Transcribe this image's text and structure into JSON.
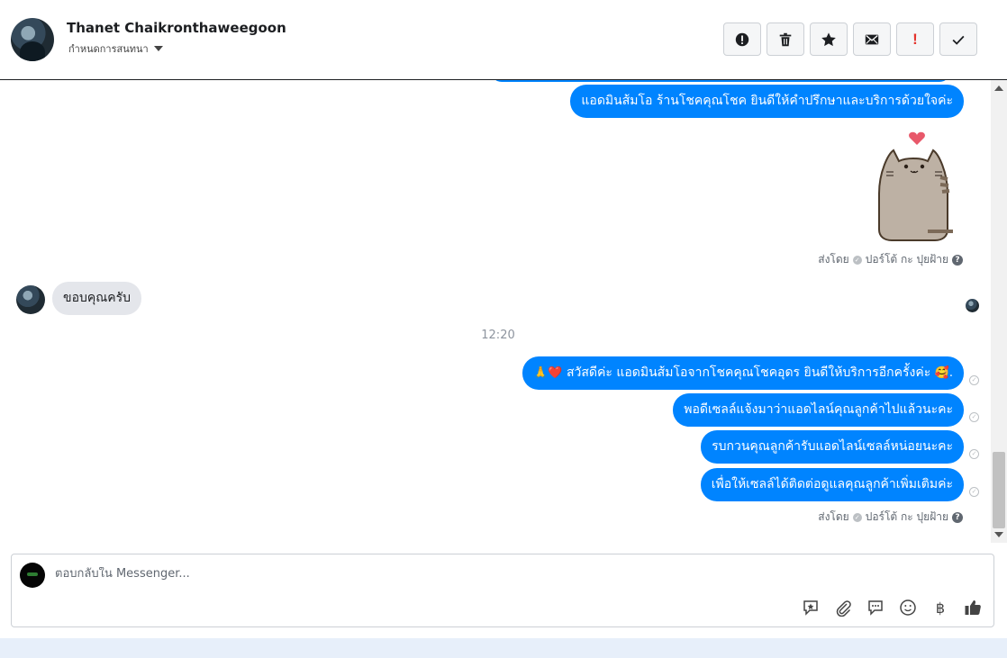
{
  "header": {
    "contact_name": "Thanet Chaikronthaweegoon",
    "assign_label": "กำหนดการสนทนา",
    "toolbar": [
      {
        "icon": "spam-icon",
        "label": "Mark as spam"
      },
      {
        "icon": "trash-icon",
        "label": "Delete"
      },
      {
        "icon": "star-icon",
        "label": "Star"
      },
      {
        "icon": "envelope-icon",
        "label": "Mark as unread"
      },
      {
        "icon": "priority-icon",
        "label": "!"
      },
      {
        "icon": "check-icon",
        "label": "Mark as done"
      }
    ]
  },
  "thread": {
    "msg_welcome": "แอดมินส้มโอ ร้านโชคคุณโชค ยินดีให้คำปรึกษาและบริการด้วยใจค่ะ",
    "sent_by_1": {
      "prefix": "ส่งโดย",
      "name": "ปอร์โต้ กะ ปุยฝ้าย",
      "help": "?"
    },
    "msg_incoming": "ขอบคุณครับ",
    "time": "12:20",
    "msg_greeting_emoji_left": "🙏❤️",
    "msg_greeting": "สวัสดีค่ะ แอดมินส้มโอจากโชคคุณโชคอุดร ยินดีให้บริการอีกครั้งค่ะ",
    "msg_greeting_emoji_right": "🥰.",
    "msg_2": "พอดีเซลล์แจ้งมาว่าแอดไลน์คุณลูกค้าไปแล้วนะคะ",
    "msg_3": "รบกวนคุณลูกค้ารับแอดไลน์เซลล์หน่อยนะคะ",
    "msg_4": "เพื่อให้เซลล์ได้ติดต่อดูแลคุณลูกค้าเพิ่มเติมค่ะ",
    "sent_by_2": {
      "prefix": "ส่งโดย",
      "name": "ปอร์โต้ กะ ปุยฝ้าย",
      "help": "?"
    }
  },
  "composer": {
    "placeholder": "ตอบกลับใน Messenger...",
    "icons": [
      "saved-reply-icon",
      "attachment-icon",
      "chat-bubble-icon",
      "emoji-icon",
      "baht-icon",
      "like-icon"
    ],
    "baht_symbol": "฿"
  },
  "colors": {
    "outgoing": "#0084ff",
    "incoming": "#e4e6eb",
    "footer": "#e7effa"
  }
}
